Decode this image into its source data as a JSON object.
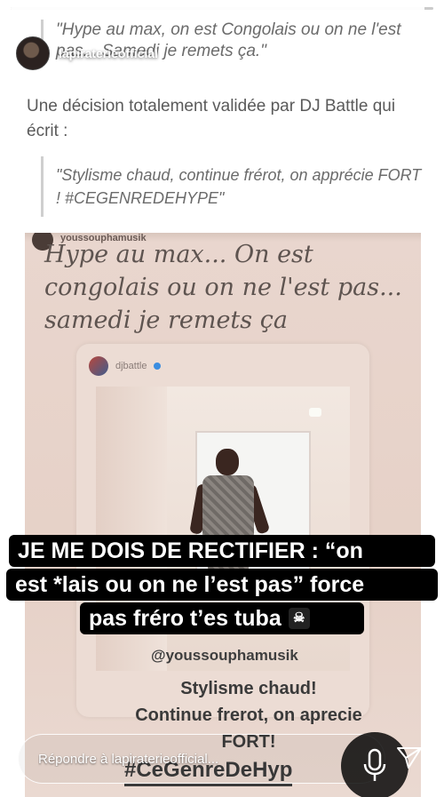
{
  "story": {
    "username": "lapiraterieofficial",
    "progress": 0.98
  },
  "article": {
    "quote1": "\"Hype au max, on est Congolais ou on ne l'est pas... Samedi je remets ça.\"",
    "paragraph": "Une décision totalement validée par DJ Battle qui écrit :",
    "quote2": "\"Stylisme chaud, continue frérot, on apprécie FORT ! #CEGENREDEHYPE\""
  },
  "embed": {
    "username": "youssouphamusik",
    "caption": "Hype au max... On est congolais ou on ne l'est pas... samedi je remets ça",
    "repost_username": "djbattle",
    "mention": "@youssouphamusik",
    "text_line1": "Stylisme chaud!",
    "text_line2": "Continue frerot, on aprecie",
    "text_line3": "FORT!",
    "hashtag": "#CeGenreDeHyp"
  },
  "overlay": {
    "line1": "JE ME DOIS DE RECTIFIER : “on",
    "line2": "est *lais ou on ne l’est pas” force",
    "line3": "pas fréro t’es tuba",
    "flag_icon": "☠"
  },
  "reply": {
    "placeholder": "Répondre à lapiraterieofficial..."
  },
  "icons": {
    "pause": "pause-icon",
    "mute": "speaker-muted-icon",
    "more": "more-icon",
    "mic": "microphone-icon",
    "send": "send-icon"
  },
  "colors": {
    "overlay_bg": "#000000",
    "embed_bg": "#e9d6ce"
  }
}
